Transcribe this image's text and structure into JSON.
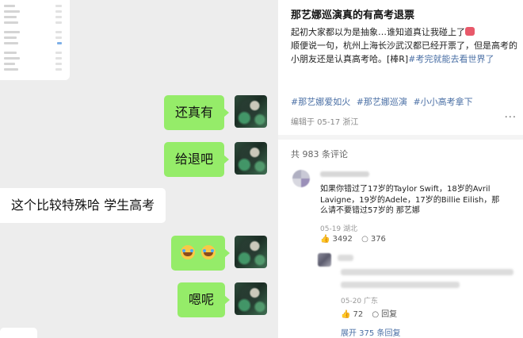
{
  "chat": {
    "messages": [
      {
        "from": "me",
        "text": "还真有"
      },
      {
        "from": "me",
        "text": "给退吧"
      },
      {
        "from": "other",
        "text": "这个比较特殊哈  学生高考"
      },
      {
        "from": "me",
        "text": "",
        "emoji": [
          "crying-laughing-emoji",
          "crying-laughing-emoji"
        ]
      },
      {
        "from": "me",
        "text": "嗯呢"
      }
    ]
  },
  "post": {
    "title": "那艺娜巡演真的有高考退票",
    "body_1": "起初大家都以为是抽象…谁知道真让我碰上了",
    "body_2": "顺便说一句，杭州上海长沙武汉都已经开票了，但是高考的小朋友还是认真高考哈。[棒R]",
    "body_link": "#考完就能去看世界了",
    "tags": [
      "#那艺娜爱如火",
      "#那艺娜巡演",
      "#小小高考拿下"
    ],
    "meta": "编辑于 05-17 浙江",
    "comment_count": "共 983 条评论"
  },
  "comment": {
    "text": "如果你错过了17岁的Taylor Swift，18岁的Avril Lavigne，19岁的Adele，17岁的Billie Eilish，那么请不要错过57岁的 那艺娜",
    "meta": "05-19 湖北",
    "likes": "3492",
    "replies": "376"
  },
  "reply": {
    "meta": "05-20 广东",
    "likes": "72",
    "reply_label": "回复"
  },
  "expand_label": "展开 375 条回复",
  "colors": {
    "link": "#4a6fa5",
    "wechat_green": "#95ec69"
  }
}
